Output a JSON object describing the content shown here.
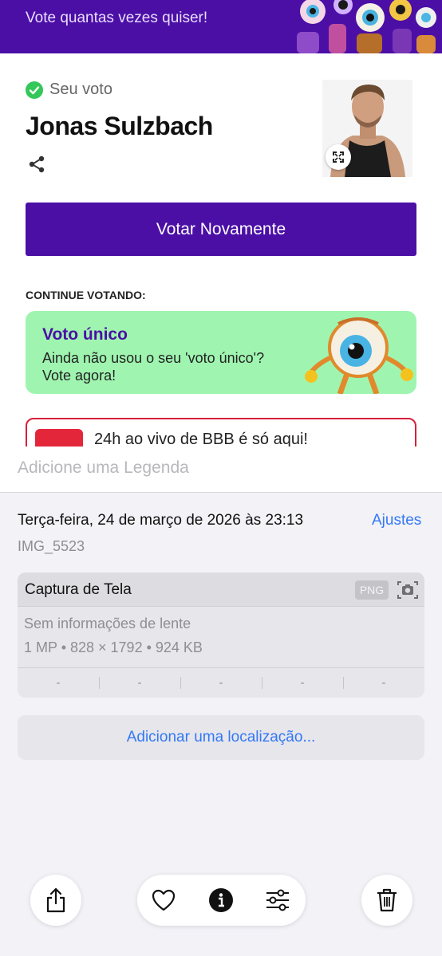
{
  "screenshot": {
    "banner_text": "Vote quantas vezes quiser!",
    "vote_label": "Seu voto",
    "candidate_name": "Jonas Sulzbach",
    "vote_again_label": "Votar Novamente",
    "continue_label": "CONTINUE VOTANDO:",
    "card": {
      "title": "Voto único",
      "line1": "Ainda não usou o seu 'voto único'?",
      "line2": "Vote agora!"
    },
    "card2_text": "24h ao vivo de BBB é só aqui!"
  },
  "caption": {
    "placeholder": "Adicione uma Legenda"
  },
  "info": {
    "date": "Terça-feira, 24 de março de 2026 às 23:13",
    "adjust_label": "Ajustes",
    "file_name": "IMG_5523"
  },
  "meta": {
    "title": "Captura de Tela",
    "format_badge": "PNG",
    "lens": "Sem informações de lente",
    "specs": "1 MP • 828 × 1792 • 924 KB",
    "exif": [
      "-",
      "-",
      "-",
      "-",
      "-"
    ]
  },
  "location": {
    "label": "Adicionar uma localização..."
  },
  "toolbar": {
    "icons": [
      "share-icon",
      "heart-icon",
      "info-icon",
      "adjust-icon",
      "trash-icon"
    ]
  },
  "colors": {
    "brand_purple": "#4b0fa6",
    "card_green": "#9ff5b0",
    "link_blue": "#3478f6",
    "alert_red": "#e4263b"
  }
}
